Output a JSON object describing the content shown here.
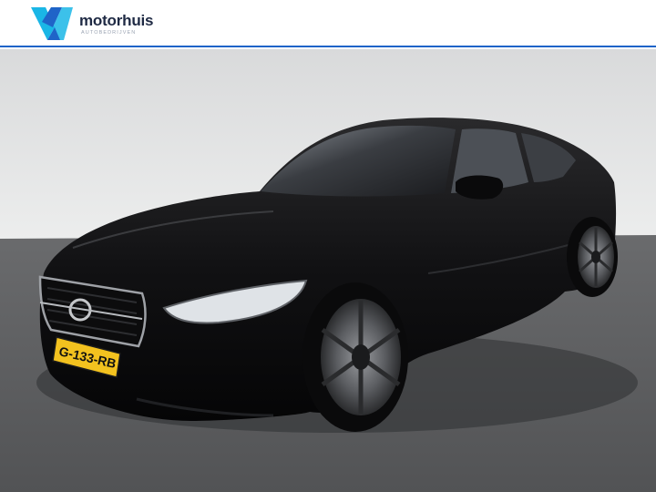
{
  "header": {
    "brand_name": "motorhuis",
    "brand_tagline": "AUTOBEDRIJVEN",
    "accent_color": "#1f64c8",
    "logo_colors": [
      "#1ab6e6",
      "#1f64c8"
    ]
  },
  "photo": {
    "subject": "black Volvo S60 sedan, front three-quarter view",
    "license_plate": "G-133-RB",
    "background_colors": {
      "wall": "#dfe0e1",
      "floor": "#5c5d5f"
    }
  }
}
